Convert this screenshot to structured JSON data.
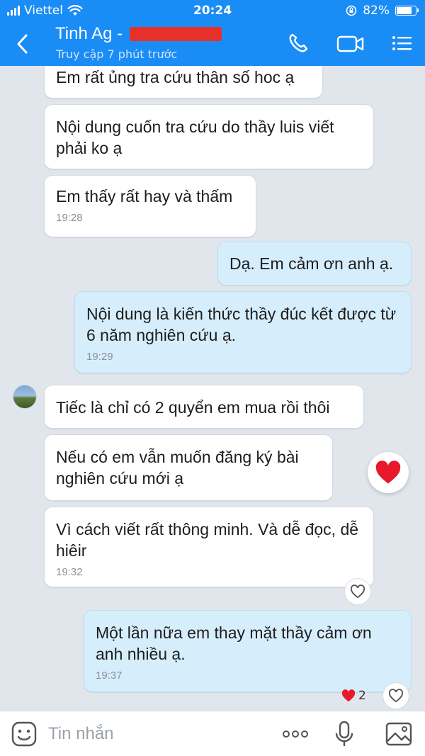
{
  "status_bar": {
    "carrier": "Viettel",
    "time": "20:24",
    "battery": "82%",
    "battery_level": 0.82
  },
  "header": {
    "contact_name": "Tinh Ag - ",
    "last_seen": "Truy cập 7 phút trước",
    "icons": [
      "back-icon",
      "phone-icon",
      "video-call-icon",
      "menu-icon"
    ]
  },
  "messages": [
    {
      "dir": "in",
      "text": "Em rất ủng tra cứu thân số hoc ạ",
      "time": ""
    },
    {
      "dir": "in",
      "text": "Nội dung cuốn tra cứu do thầy luis viết phải ko ạ",
      "time": ""
    },
    {
      "dir": "in",
      "text": "Em thấy rất hay và thấm",
      "time": "19:28"
    },
    {
      "dir": "out",
      "text": "Dạ. Em cảm ơn anh ạ.",
      "time": ""
    },
    {
      "dir": "out",
      "text": "Nội dung là kiến thức thầy đúc kết được từ 6 năm nghiên cứu ạ.",
      "time": "19:29"
    },
    {
      "dir": "in",
      "text": "Tiếc là chỉ có 2 quyển em mua rồi thôi",
      "time": ""
    },
    {
      "dir": "in",
      "text": "Nếu có em vẫn muốn đăng ký bài nghiên cứu mới ạ",
      "time": ""
    },
    {
      "dir": "in",
      "text": "Vì cách viết rất thông minh. Và dễ đọc, dễ hiêir",
      "time": "19:32"
    },
    {
      "dir": "out",
      "text": "Một lần  nữa em thay mặt thầy cảm ơn anh nhiều ạ.",
      "time": "19:37"
    }
  ],
  "reactions": {
    "last_message_count": "2"
  },
  "composer": {
    "placeholder": "Tin nhắn",
    "icons": [
      "sticker-icon",
      "more-icon",
      "microphone-icon",
      "image-icon"
    ]
  },
  "colors": {
    "header_blue": "#1a8cf5",
    "chat_background": "#e1e6ec",
    "outgoing_bubble": "#d6eefc",
    "incoming_bubble": "#ffffff",
    "heart_red": "#e8192c"
  }
}
